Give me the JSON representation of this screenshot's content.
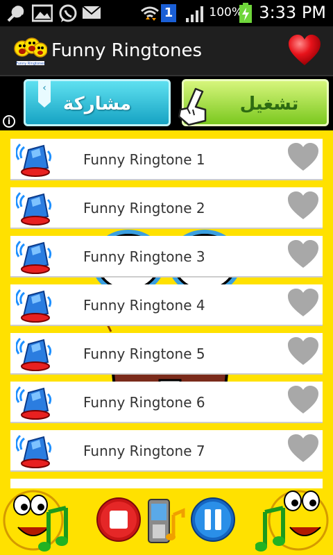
{
  "status_bar": {
    "battery_percent": "100%",
    "time": "3:33 PM",
    "sim_badge": "1"
  },
  "header": {
    "title": "Funny Ringtones",
    "logo_caption": "Funny Ringtones"
  },
  "banner": {
    "share_label": "مشاركة",
    "play_label": "تشغيل",
    "info_label": "i"
  },
  "ringtones": [
    {
      "name": "Funny Ringtone 1"
    },
    {
      "name": "Funny Ringtone 2"
    },
    {
      "name": "Funny Ringtone 3"
    },
    {
      "name": "Funny Ringtone 4"
    },
    {
      "name": "Funny Ringtone 5"
    },
    {
      "name": "Funny Ringtone 6"
    },
    {
      "name": "Funny Ringtone 7"
    }
  ],
  "icons": {
    "header": [
      "app-logo-icon",
      "favorite-heart-icon"
    ],
    "status": [
      "wrench-icon",
      "image-icon",
      "whatsapp-icon",
      "mail-icon",
      "wifi-icon",
      "signal-icon",
      "battery-icon"
    ],
    "row": [
      "bell-icon",
      "heart-icon"
    ],
    "bottom": [
      "stop-icon",
      "music-phone-icon",
      "pause-icon"
    ]
  },
  "colors": {
    "background": "#ffe100",
    "heart_red": "#e8131b",
    "heart_grey": "#a8a8a8",
    "share_button": "#16a3c3",
    "play_button": "#7bc81f"
  }
}
